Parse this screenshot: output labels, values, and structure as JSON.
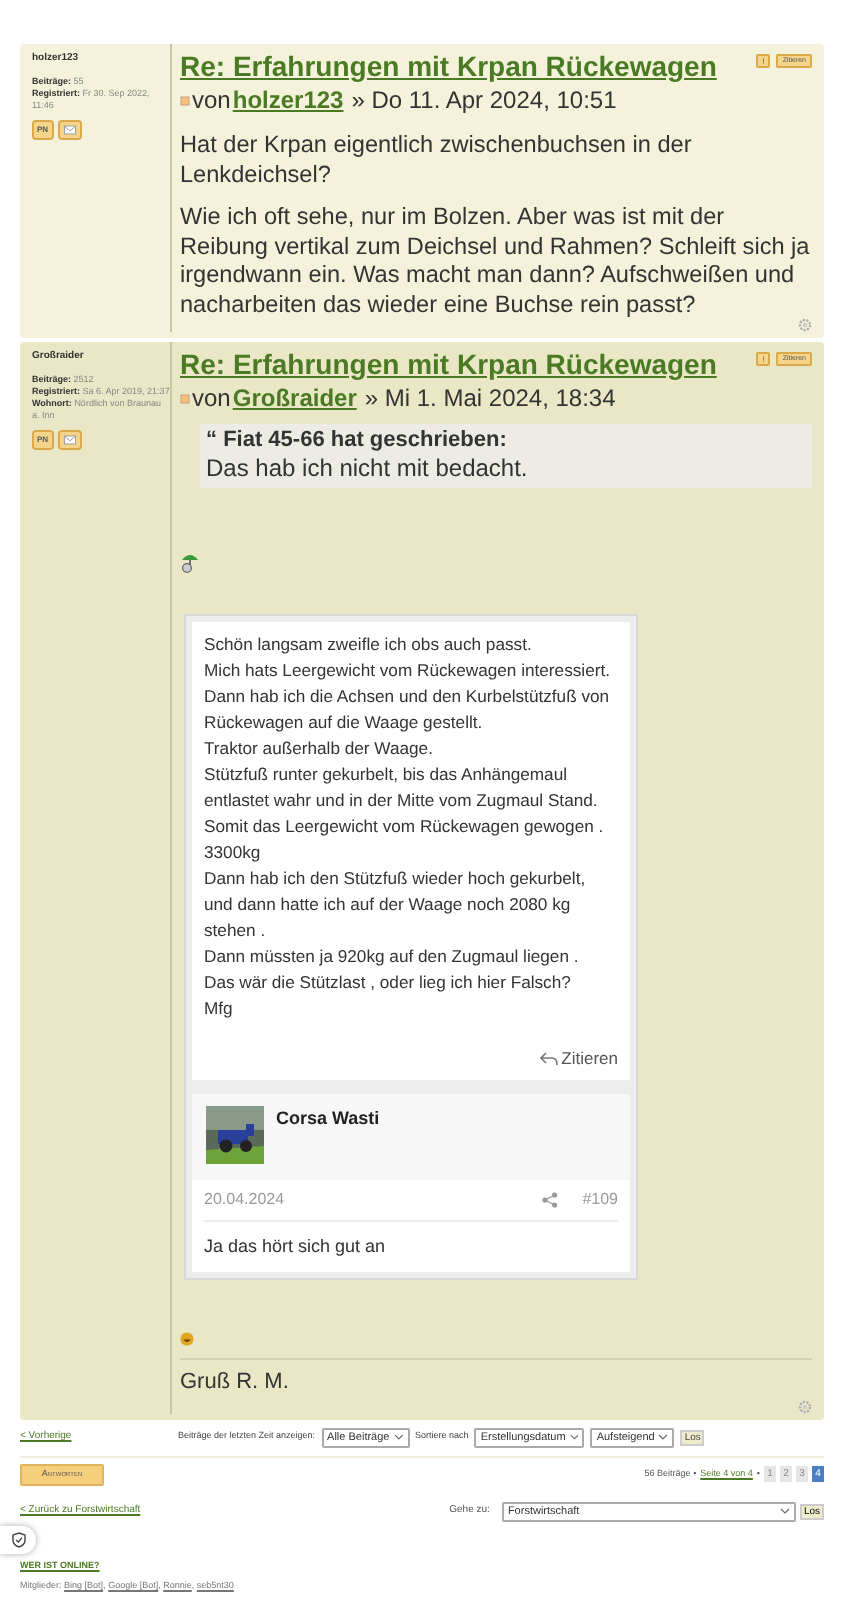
{
  "posts": [
    {
      "profile": {
        "username": "holzer123",
        "fields": [
          {
            "label": "Beiträge:",
            "value": "55"
          },
          {
            "label": "Registriert:",
            "value": "Fr 30. Sep 2022, 11:46"
          }
        ],
        "pm": "PN"
      },
      "report": "!",
      "quote_button": "Zitieren",
      "title": "Re: Erfahrungen mit Krpan Rückewagen",
      "by": "von",
      "author": "holzer123",
      "date": "» Do 11. Apr 2024, 10:51",
      "body": [
        "Hat der Krpan eigentlich zwischenbuchsen in der Lenkdeichsel?",
        "Wie ich oft sehe, nur im Bolzen. Aber was ist mit der Reibung vertikal zum Deichsel und Rahmen? Schleift sich ja irgendwann ein. Was macht man dann? Aufschweißen und nacharbeiten das wieder eine Buchse rein passt?"
      ]
    },
    {
      "profile": {
        "username": "Großraider",
        "fields": [
          {
            "label": "Beiträge:",
            "value": "2512"
          },
          {
            "label": "Registriert:",
            "value": "Sa 6. Apr 2019, 21:37"
          },
          {
            "label": "Wohnort:",
            "value": "Nördlich von Braunau a. Inn"
          }
        ],
        "pm": "PN"
      },
      "report": "!",
      "quote_button": "Zitieren",
      "title": "Re: Erfahrungen mit Krpan Rückewagen",
      "by": "von",
      "author": "Großraider",
      "date": "» Mi 1. Mai 2024, 18:34",
      "quote": {
        "mark": "“",
        "header": "Fiat 45-66 hat geschrieben:",
        "text": "Das hab ich nicht mit bedacht."
      },
      "embedded": {
        "lines": [
          "Schön langsam zweifle ich obs auch passt.",
          "Mich hats Leergewicht vom Rückewagen interessiert.",
          "Dann hab ich die Achsen und den Kurbelstützfuß von Rückewagen auf die Waage gestellt.",
          "Traktor außerhalb der Waage.",
          "Stützfuß runter gekurbelt, bis das Anhängemaul entlastet wahr und in der Mitte vom Zugmaul Stand.",
          "Somit das Leergewicht vom Rückewagen gewogen . 3300kg",
          "Dann hab ich den Stützfuß wieder hoch gekurbelt, und dann hatte ich auf der Waage noch 2080 kg stehen .",
          "Dann müssten ja 920kg auf den Zugmaul liegen .",
          "Das wär die Stützlast , oder lieg ich hier Falsch?",
          "Mfg"
        ],
        "quote_action": "Zitieren",
        "reply": {
          "name": "Corsa Wasti",
          "date": "20.04.2024",
          "number": "#109",
          "text": "Ja das hört sich gut an"
        }
      },
      "signature": "Gruß R. M."
    }
  ],
  "footer": {
    "previous": "< Vorherige",
    "show_label": "Beiträge der letzten Zeit anzeigen:",
    "show_value": "Alle Beiträge",
    "sort_label": "Sortiere nach",
    "sort_value": "Erstellungsdatum",
    "order_value": "Aufsteigend",
    "go": "Los",
    "reply_button": "Antworten",
    "count": "56 Beiträge •",
    "page_link": "Seite 4 von 4",
    "sep": "•",
    "pages": [
      {
        "label": "1",
        "selected": false
      },
      {
        "label": "2",
        "selected": false
      },
      {
        "label": "3",
        "selected": false
      },
      {
        "label": "4",
        "selected": true
      }
    ],
    "back": "< Zurück zu Forstwirtschaft",
    "jump_label": "Gehe zu:",
    "jump_value": "Forstwirtschaft",
    "jump_go": "Los",
    "online_title": "WER IST ONLINE?",
    "members_label": "Mitglieder:",
    "member_sep": ",",
    "members": [
      "Bing [Bot]",
      "Google [Bot]",
      "Ronnie",
      "seb5nt30"
    ]
  }
}
